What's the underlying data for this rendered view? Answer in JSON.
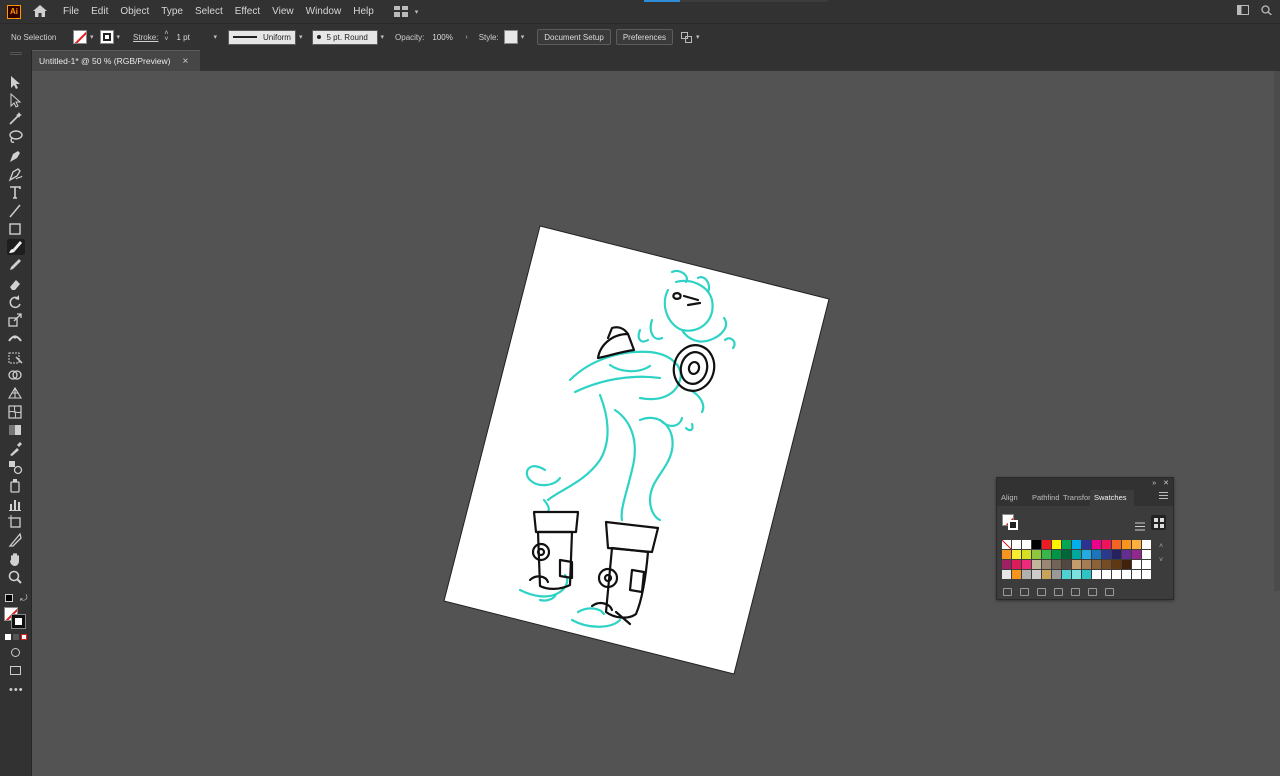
{
  "app": {
    "logo_text": "Ai"
  },
  "menu": [
    "File",
    "Edit",
    "Object",
    "Type",
    "Select",
    "Effect",
    "View",
    "Window",
    "Help"
  ],
  "control_bar": {
    "selection_label": "No Selection",
    "stroke_label": "Stroke:",
    "stroke_weight": "1 pt",
    "variable_width": "Uniform",
    "brush_def": "5 pt. Round",
    "opacity_label": "Opacity:",
    "opacity_value": "100%",
    "style_label": "Style:",
    "document_setup": "Document Setup",
    "preferences": "Preferences"
  },
  "document_tab": {
    "title": "Untitled-1* @ 50 % (RGB/Preview)",
    "close_glyph": "×"
  },
  "tools": [
    "selection-tool-icon",
    "direct-selection-tool-icon",
    "magic-wand-tool-icon",
    "lasso-tool-icon",
    "pen-tool-icon",
    "curvature-tool-icon",
    "type-tool-icon",
    "line-segment-tool-icon",
    "rectangle-tool-icon",
    "paintbrush-tool-icon",
    "pencil-tool-icon",
    "eraser-tool-icon",
    "rotate-tool-icon",
    "scale-tool-icon",
    "width-tool-icon",
    "free-transform-tool-icon",
    "shape-builder-tool-icon",
    "perspective-grid-tool-icon",
    "mesh-tool-icon",
    "gradient-tool-icon",
    "eyedropper-tool-icon",
    "blend-tool-icon",
    "symbol-sprayer-tool-icon",
    "column-graph-tool-icon",
    "artboard-tool-icon",
    "slice-tool-icon",
    "hand-tool-icon",
    "zoom-tool-icon"
  ],
  "swatches_panel": {
    "tabs": [
      "Align",
      "Pathfinder",
      "Transform",
      "Swatches"
    ],
    "active_tab": "Swatches",
    "colors": [
      "#ffffff",
      "#ffffff",
      "#ffffff",
      "#000000",
      "#ed1c24",
      "#fff200",
      "#00a651",
      "#00aeef",
      "#2e3192",
      "#ec008c",
      "#ed145b",
      "#f26522",
      "#f7941d",
      "#fbb040",
      "#ffffff",
      "#f7941d",
      "#f9ed32",
      "#d7df23",
      "#8dc63f",
      "#39b54a",
      "#009444",
      "#006838",
      "#00a79d",
      "#27aae1",
      "#1c75bc",
      "#2b388f",
      "#262262",
      "#662d91",
      "#92278f",
      "#ffffff",
      "#9e1f63",
      "#da1c5c",
      "#ee2a7b",
      "#c2b59b",
      "#998675",
      "#736357",
      "#534741",
      "#c69c6d",
      "#a67c52",
      "#8c6239",
      "#754c24",
      "#603913",
      "#42210b",
      "#ffffff",
      "#ffffff",
      "#e6e6e6",
      "#f7941d",
      "#b0b0b0",
      "#cccccc",
      "#c8a45a",
      "#999999",
      "#4dd2d2",
      "#7ae1e1",
      "#2ec4c4",
      "#ffffff",
      "#ffffff",
      "#ffffff",
      "#ffffff",
      "#ffffff",
      "#ffffff"
    ]
  }
}
